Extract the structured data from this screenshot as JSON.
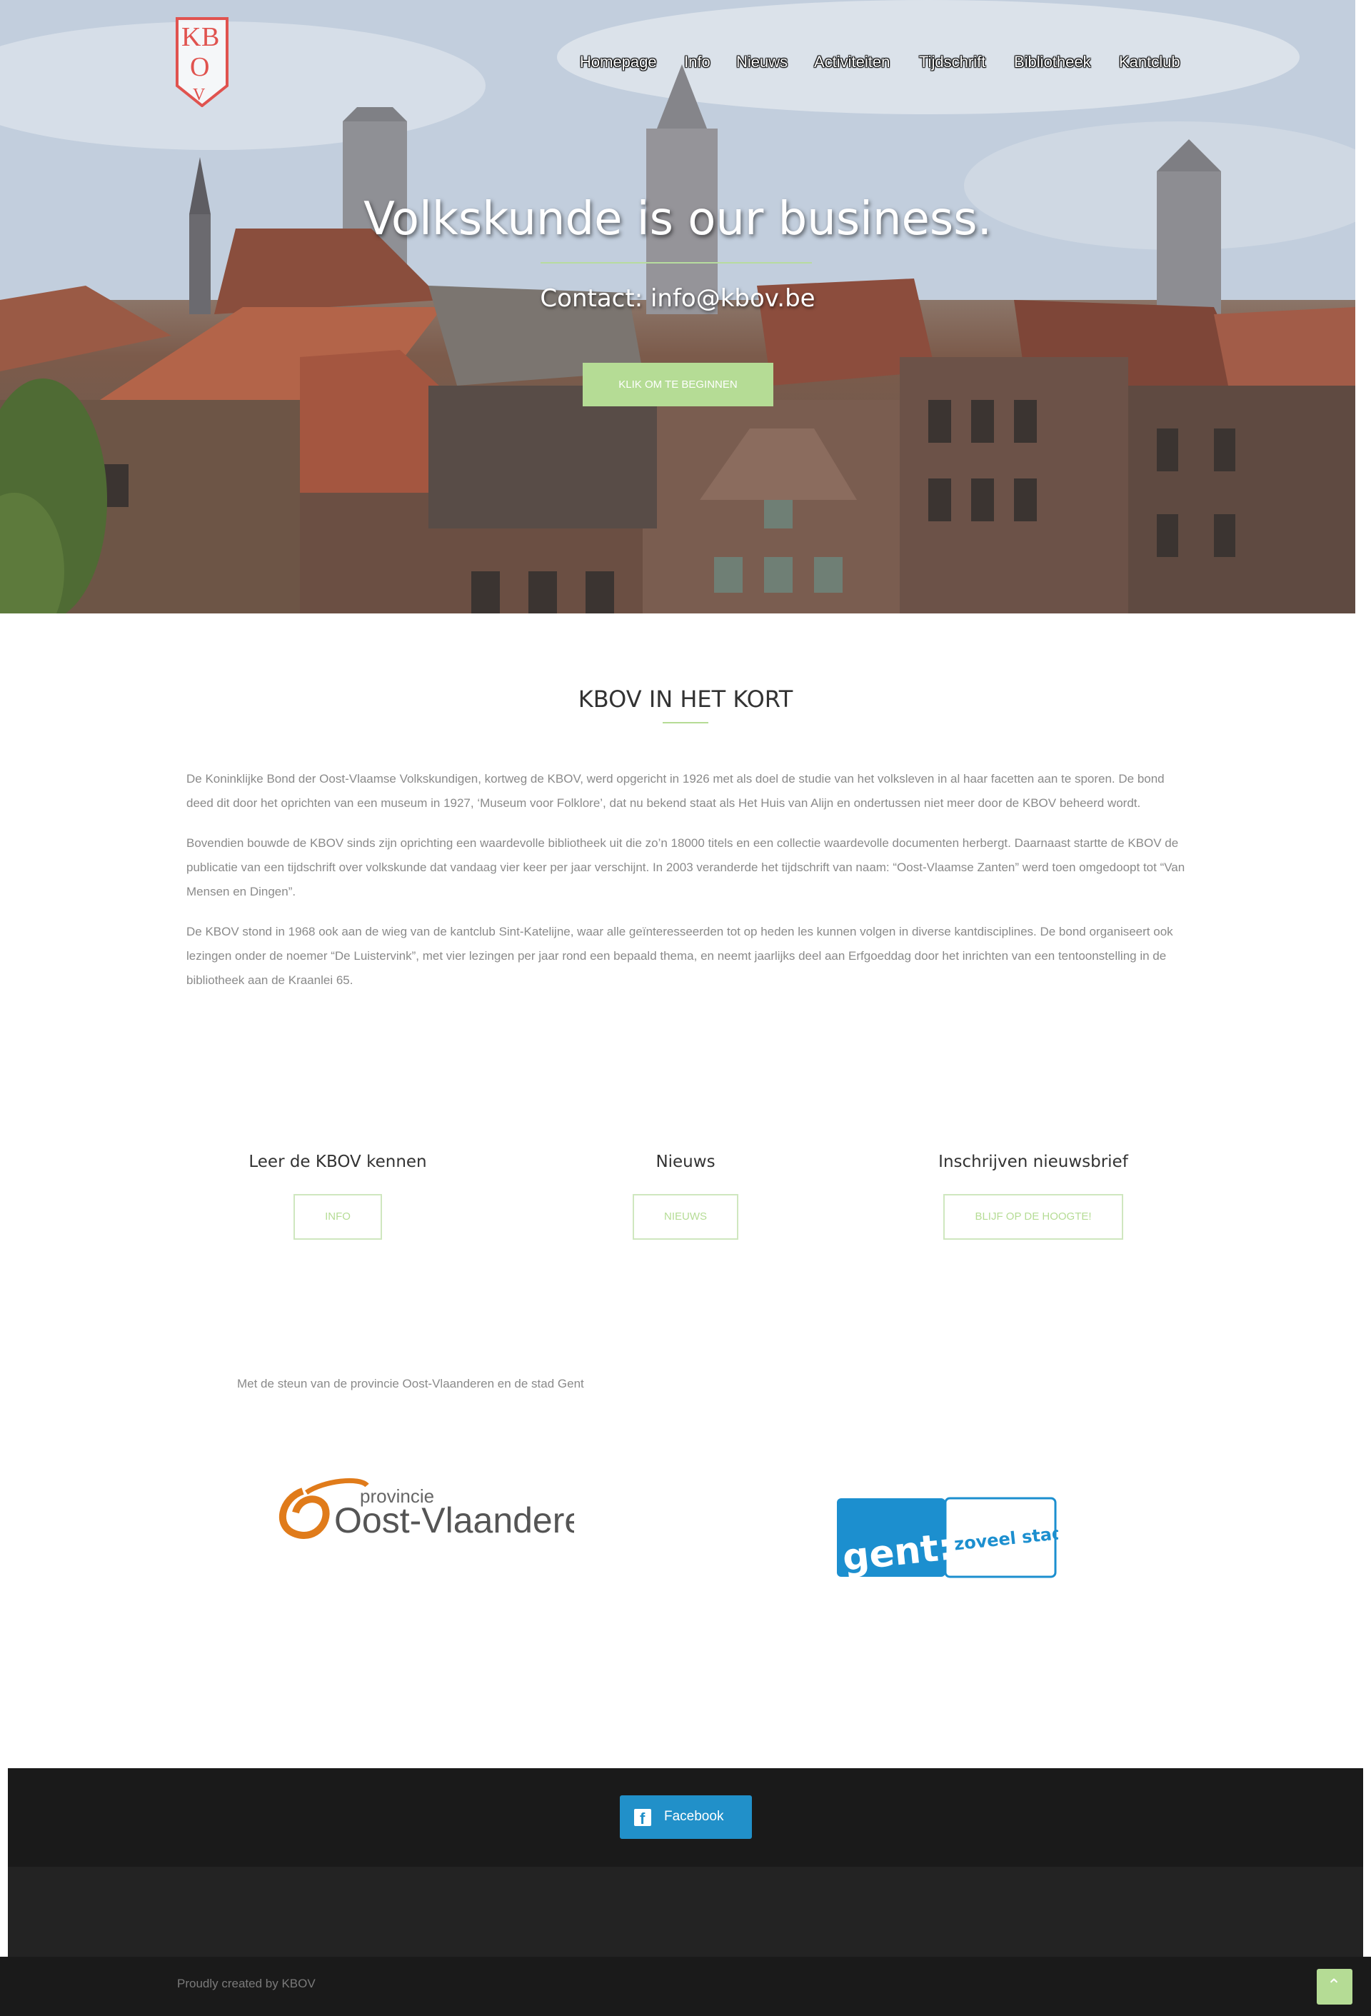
{
  "nav": {
    "items": [
      "Homepage",
      "Info",
      "Nieuws",
      "Activiteiten",
      "Tijdschrift",
      "Bibliotheek",
      "Kantclub"
    ]
  },
  "logo": {
    "text": "KBOV"
  },
  "hero": {
    "title": "Volkskunde is our business.",
    "subtitle": "Contact: info@kbov.be",
    "button": "KLIK OM TE BEGINNEN"
  },
  "intro": {
    "title": "KBOV IN HET KORT",
    "paragraphs": [
      "De Koninklijke Bond der Oost-Vlaamse Volkskundigen, kortweg de KBOV, werd opgericht in 1926 met als doel de studie van het volksleven in al haar facetten aan te sporen. De bond deed dit door het oprichten van een museum in 1927, ‘Museum voor Folklore’, dat nu bekend staat als Het Huis van Alijn en ondertussen niet meer door de KBOV beheerd wordt.",
      "Bovendien bouwde de KBOV sinds zijn oprichting een waardevolle bibliotheek uit die zo’n 18000 titels en een collectie waardevolle documenten herbergt. Daarnaast startte de KBOV de publicatie van een tijdschrift over volkskunde dat vandaag vier keer per jaar verschijnt. In 2003 veranderde het tijdschrift van naam: “Oost-Vlaamse Zanten” werd toen omgedoopt tot “Van Mensen en Dingen”.",
      "De KBOV stond in 1968 ook aan de wieg van de kantclub Sint-Katelijne, waar alle geïnteresseerden tot op heden les kunnen volgen in diverse kantdisciplines. De bond organiseert ook lezingen onder de noemer “De Luistervink”, met vier lezingen per jaar rond een bepaald thema, en neemt jaarlijks deel aan Erfgoeddag door het inrichten van een tentoonstelling in de bibliotheek aan de Kraanlei 65."
    ]
  },
  "features": [
    {
      "title": "Leer de KBOV kennen",
      "button": "INFO"
    },
    {
      "title": "Nieuws",
      "button": "NIEUWS"
    },
    {
      "title": "Inschrijven nieuwsbrief",
      "button": "BLIJF OP DE HOOGTE!"
    }
  ],
  "support": {
    "text": "Met de steun van de provincie Oost-Vlaanderen en de stad Gent",
    "logo_ov_small": "provincie",
    "logo_ov_big": "Oost-Vlaanderen",
    "logo_gent_left": "gent:",
    "logo_gent_right": "zoveel stad"
  },
  "footer": {
    "facebook": "Facebook",
    "credit": "Proudly created by KBOV",
    "to_top_icon": "chevron-up-icon"
  },
  "colors": {
    "accent": "#b5dc95",
    "facebook": "#2190c9",
    "logo_red": "#e0534f",
    "footer_dark": "#1a1a1a"
  }
}
